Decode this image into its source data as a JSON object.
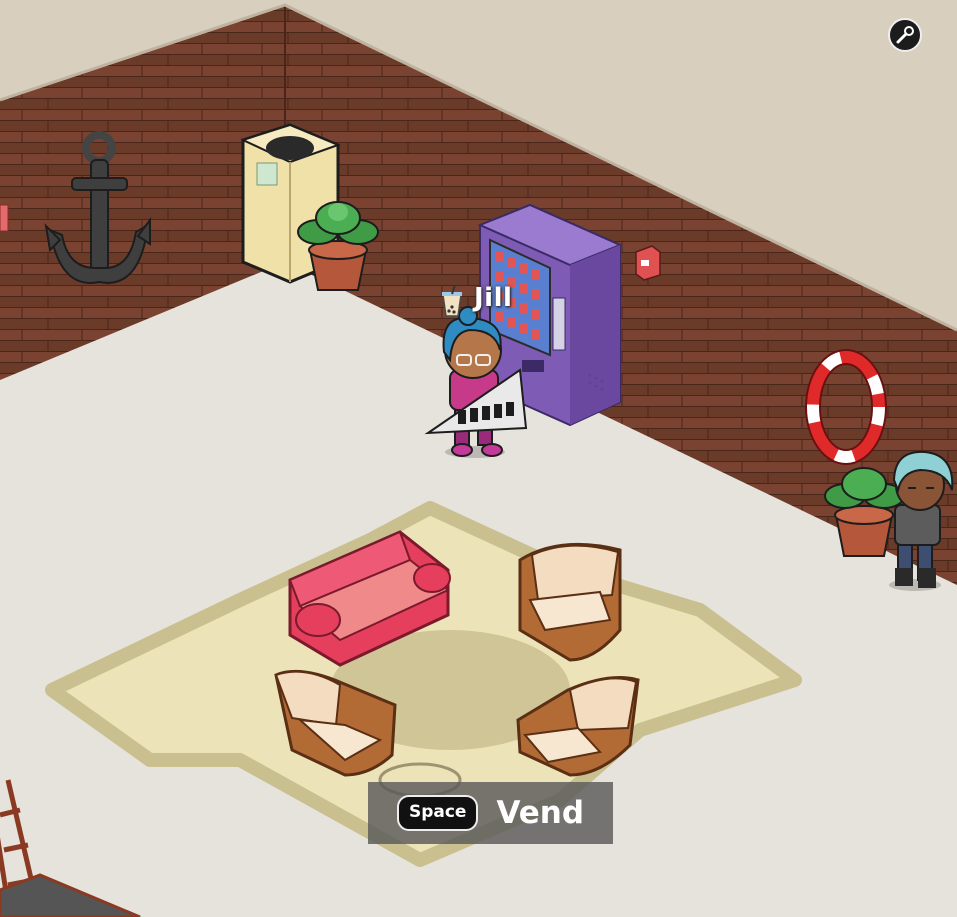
{
  "player": {
    "name": "Jill"
  },
  "interaction_prompt": {
    "key": "Space",
    "action": "Vend"
  },
  "icons": {
    "settings": "settings-wrench-icon"
  },
  "colors": {
    "floor": "#e6e2dc",
    "wall_wood": "#6b3b2a",
    "wall_top": "#d8cfbf",
    "rug": "#ece4b8",
    "sofa": "#e63f5d",
    "armchair": "#f1d6b6",
    "vending_machine": "#7e5bb5",
    "prompt_bg": "#5a5a5a"
  }
}
